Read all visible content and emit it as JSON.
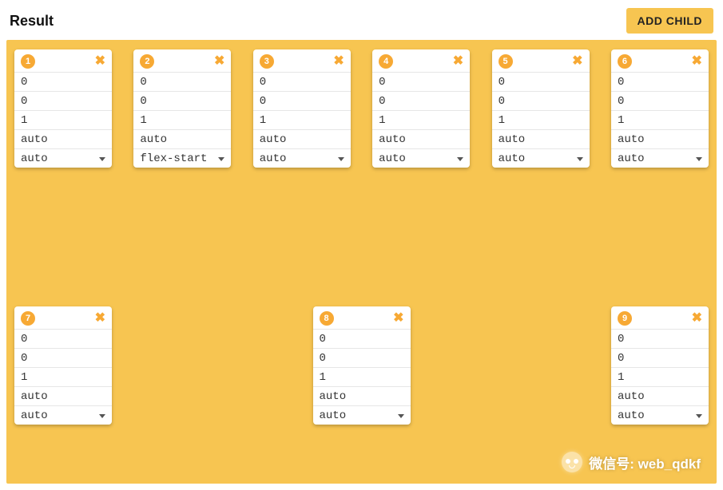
{
  "header": {
    "title": "Result",
    "add_label": "ADD CHILD"
  },
  "cards": [
    {
      "n": "1",
      "grow": "0",
      "shrink": "0",
      "basis": "1",
      "align": "auto",
      "justify": "auto"
    },
    {
      "n": "2",
      "grow": "0",
      "shrink": "0",
      "basis": "1",
      "align": "auto",
      "justify": "flex-start"
    },
    {
      "n": "3",
      "grow": "0",
      "shrink": "0",
      "basis": "1",
      "align": "auto",
      "justify": "auto"
    },
    {
      "n": "4",
      "grow": "0",
      "shrink": "0",
      "basis": "1",
      "align": "auto",
      "justify": "auto"
    },
    {
      "n": "5",
      "grow": "0",
      "shrink": "0",
      "basis": "1",
      "align": "auto",
      "justify": "auto"
    },
    {
      "n": "6",
      "grow": "0",
      "shrink": "0",
      "basis": "1",
      "align": "auto",
      "justify": "auto"
    },
    {
      "n": "7",
      "grow": "0",
      "shrink": "0",
      "basis": "1",
      "align": "auto",
      "justify": "auto"
    },
    {
      "n": "8",
      "grow": "0",
      "shrink": "0",
      "basis": "1",
      "align": "auto",
      "justify": "auto"
    },
    {
      "n": "9",
      "grow": "0",
      "shrink": "0",
      "basis": "1",
      "align": "auto",
      "justify": "auto"
    }
  ],
  "watermark": {
    "text": "微信号: web_qdkf"
  }
}
